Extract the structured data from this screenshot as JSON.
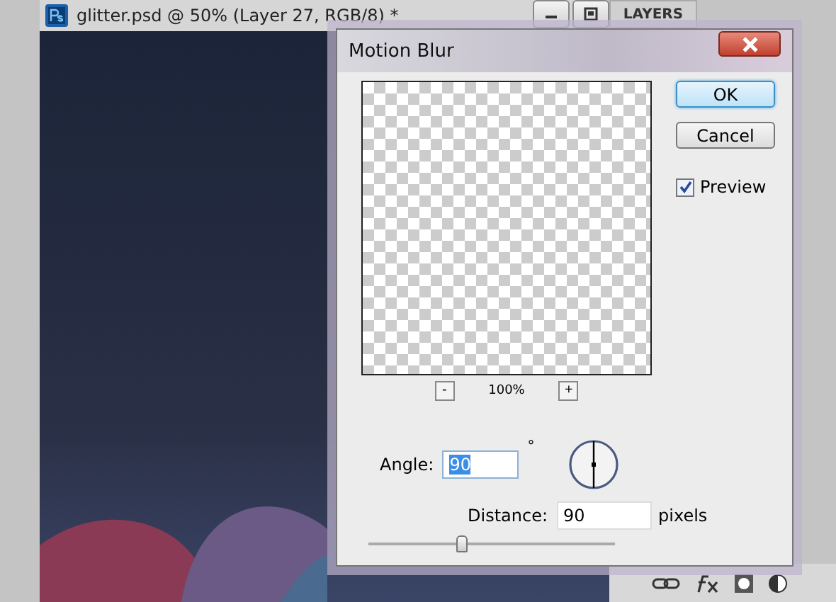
{
  "document": {
    "title": "glitter.psd @ 50% (Layer 27, RGB/8) *"
  },
  "layers_panel": {
    "tab": "LAYERS"
  },
  "dialog": {
    "title": "Motion Blur",
    "zoom": "100%",
    "zoom_out": "-",
    "zoom_in": "+",
    "buttons": [
      {
        "label": "OK",
        "default": true
      },
      {
        "label": "Cancel",
        "default": false
      }
    ],
    "preview": {
      "label": "Preview",
      "checked": true
    },
    "angle": {
      "label": "Angle:",
      "value": "90",
      "unit": "°"
    },
    "distance": {
      "label": "Distance:",
      "value": "90",
      "unit": "pixels",
      "level": 0.38
    }
  }
}
